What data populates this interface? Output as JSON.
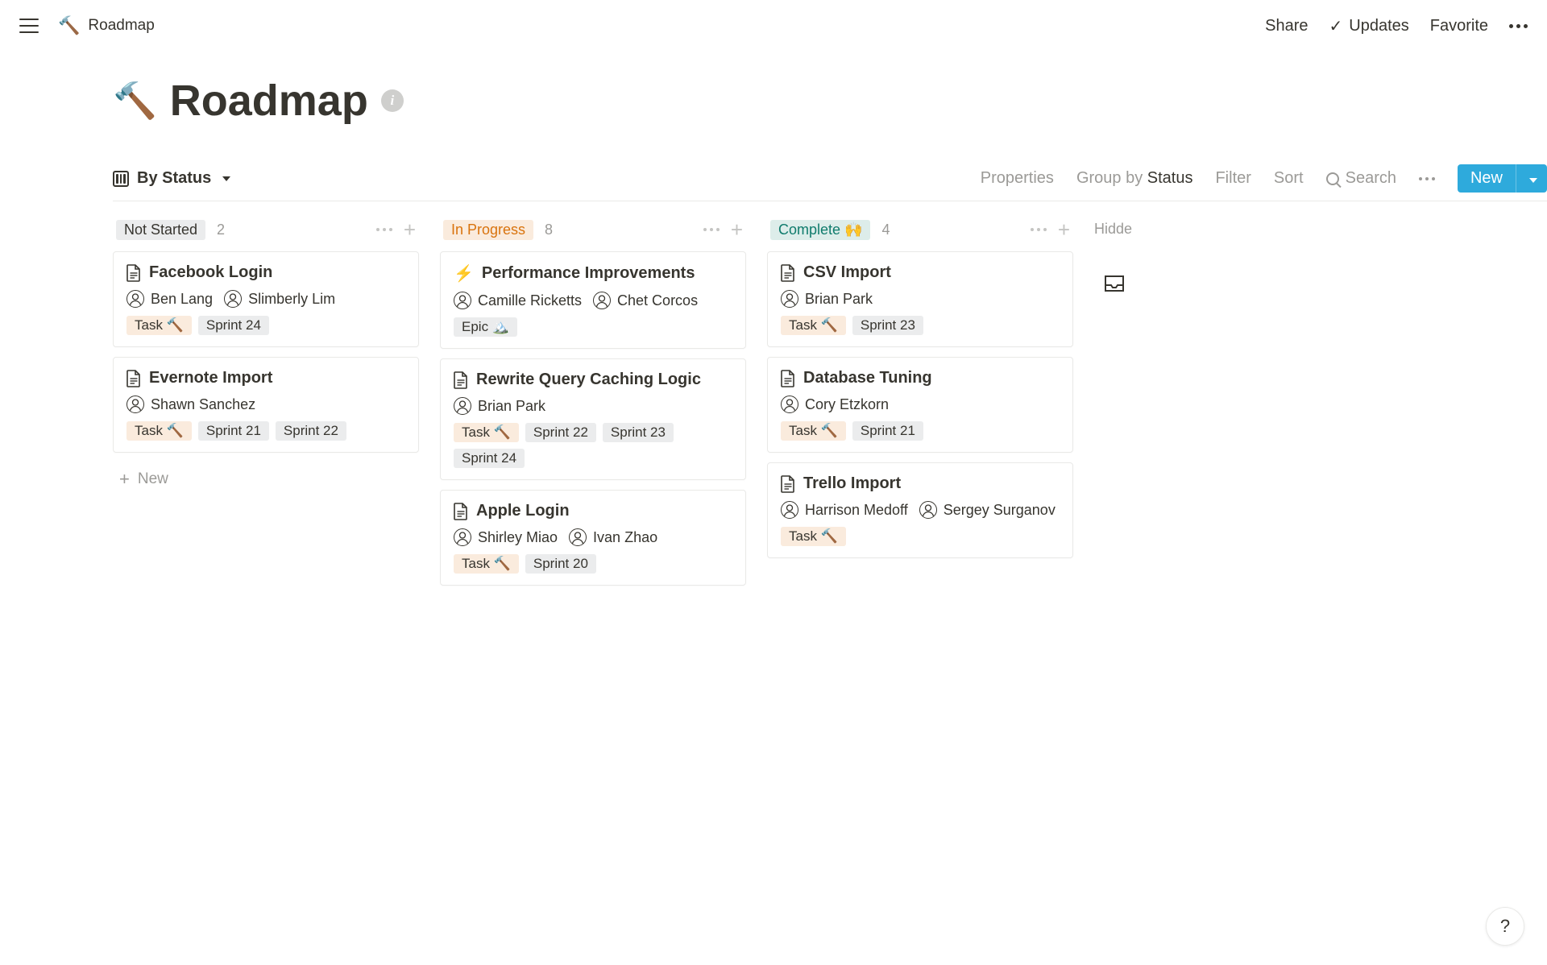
{
  "topbar": {
    "breadcrumb_title": "Roadmap",
    "share": "Share",
    "updates": "Updates",
    "favorite": "Favorite"
  },
  "page": {
    "title": "Roadmap"
  },
  "toolbar": {
    "view_label": "By Status",
    "properties": "Properties",
    "group_by_prefix": "Group by ",
    "group_by_value": "Status",
    "filter": "Filter",
    "sort": "Sort",
    "search": "Search",
    "new_label": "New"
  },
  "columns": [
    {
      "title": "Not Started",
      "style": "grey",
      "count": "2",
      "cards": [
        {
          "icon": "page",
          "title": "Facebook Login",
          "people": [
            "Ben Lang",
            "Slimberly Lim"
          ],
          "tags": [
            {
              "type": "task",
              "label": "Task 🔨"
            },
            {
              "type": "sprint",
              "label": "Sprint 24"
            }
          ]
        },
        {
          "icon": "page",
          "title": "Evernote Import",
          "people": [
            "Shawn Sanchez"
          ],
          "tags": [
            {
              "type": "task",
              "label": "Task 🔨"
            },
            {
              "type": "sprint",
              "label": "Sprint 21"
            },
            {
              "type": "sprint",
              "label": "Sprint 22"
            }
          ]
        }
      ],
      "new_label": "New"
    },
    {
      "title": "In Progress",
      "style": "orange",
      "count": "8",
      "cards": [
        {
          "icon": "bolt",
          "title": "Performance Improvements",
          "people": [
            "Camille Ricketts",
            "Chet Corcos"
          ],
          "tags": [
            {
              "type": "epic",
              "label": "Epic 🏔️"
            }
          ]
        },
        {
          "icon": "page",
          "title": "Rewrite Query Caching Logic",
          "people": [
            "Brian Park"
          ],
          "tags": [
            {
              "type": "task",
              "label": "Task 🔨"
            },
            {
              "type": "sprint",
              "label": "Sprint 22"
            },
            {
              "type": "sprint",
              "label": "Sprint 23"
            },
            {
              "type": "sprint",
              "label": "Sprint 24"
            }
          ]
        },
        {
          "icon": "page",
          "title": "Apple Login",
          "people": [
            "Shirley Miao",
            "Ivan Zhao"
          ],
          "tags": [
            {
              "type": "task",
              "label": "Task 🔨"
            },
            {
              "type": "sprint",
              "label": "Sprint 20"
            }
          ]
        }
      ]
    },
    {
      "title": "Complete 🙌",
      "style": "green",
      "count": "4",
      "cards": [
        {
          "icon": "page",
          "title": "CSV Import",
          "people": [
            "Brian Park"
          ],
          "tags": [
            {
              "type": "task",
              "label": "Task 🔨"
            },
            {
              "type": "sprint",
              "label": "Sprint 23"
            }
          ]
        },
        {
          "icon": "page",
          "title": "Database Tuning",
          "people": [
            "Cory Etzkorn"
          ],
          "tags": [
            {
              "type": "task",
              "label": "Task 🔨"
            },
            {
              "type": "sprint",
              "label": "Sprint 21"
            }
          ]
        },
        {
          "icon": "page",
          "title": "Trello Import",
          "people": [
            "Harrison Medoff",
            "Sergey Surganov"
          ],
          "tags": [
            {
              "type": "task",
              "label": "Task 🔨"
            }
          ]
        }
      ]
    }
  ],
  "hidden_label": "Hidde",
  "help": "?"
}
